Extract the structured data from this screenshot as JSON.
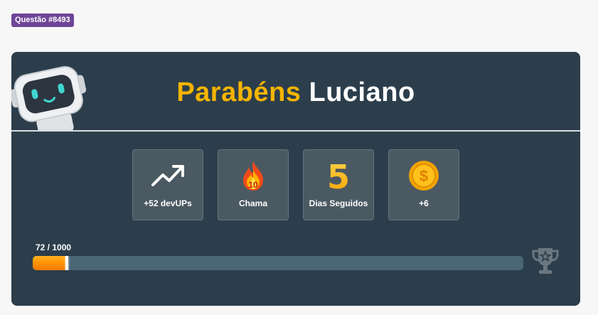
{
  "question_badge": "Questão #8493",
  "title": {
    "word1": "Parabéns",
    "word2": "Luciano"
  },
  "stats": [
    {
      "icon": "trending-up-icon",
      "label": "+52 devUPs"
    },
    {
      "icon": "flame-icon",
      "label": "Chama",
      "icon_value": "10"
    },
    {
      "icon": "number-five-icon",
      "label": "Dias Seguidos",
      "icon_value": "5"
    },
    {
      "icon": "dollar-coin-icon",
      "label": "+6",
      "icon_value": "$"
    }
  ],
  "progress": {
    "label": "72 / 1000",
    "current": 72,
    "max": 1000,
    "shown_fraction": 0.07
  },
  "colors": {
    "accent": "#f5b400",
    "card_bg": "#2c3e4c",
    "badge_bg": "#6f4597",
    "progress_fill": "#ff8c00"
  }
}
